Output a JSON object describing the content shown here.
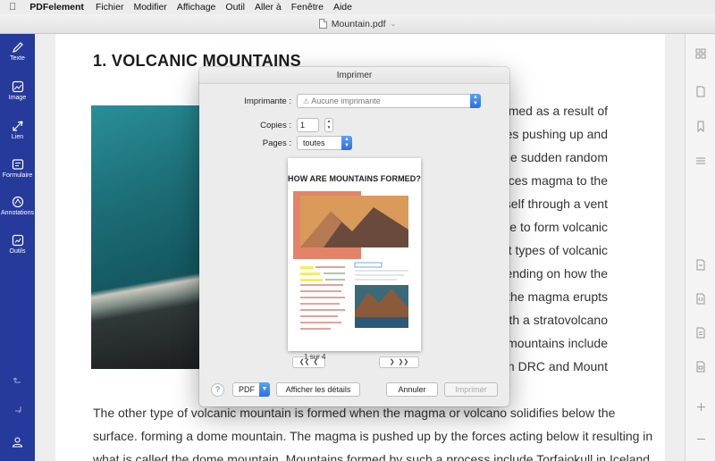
{
  "menubar": {
    "app": "PDFelement",
    "items": [
      "Fichier",
      "Modifier",
      "Affichage",
      "Outil",
      "Aller à",
      "Fenêtre",
      "Aide"
    ]
  },
  "window": {
    "filename": "Mountain.pdf"
  },
  "left_sidebar": {
    "tools": [
      {
        "label": "Texte",
        "icon": "pencil-icon"
      },
      {
        "label": "Image",
        "icon": "image-icon"
      },
      {
        "label": "Lien",
        "icon": "link-icon"
      },
      {
        "label": "Formulaire",
        "icon": "form-icon"
      },
      {
        "label": "Annotations",
        "icon": "annotation-icon"
      },
      {
        "label": "Outils",
        "icon": "tools-icon"
      }
    ]
  },
  "document": {
    "heading": "1. VOLCANIC MOUNTAINS",
    "right_lines": [
      "ormed as a result of",
      "ates pushing up and",
      "r. The sudden random",
      "rces magma to the",
      "es itself through a vent",
      "face to form volcanic",
      "rent types of volcanic",
      "depending on how the",
      "e, if the magma erupts",
      "earth a stratovolcano",
      "ch mountains include",
      "ra in DRC and Mount"
    ],
    "full_lines": [
      "The other type of volcanic mountain is formed when the magma or volcano solidifies below the",
      "surface. forming a dome mountain. The magma is pushed up by the forces acting below it resulting in",
      "what is called the dome mountain. Mountains formed by such a process include Torfajokull in Iceland"
    ]
  },
  "print_dialog": {
    "title": "Imprimer",
    "printer_label": "Imprimante :",
    "printer_value": "Aucune imprimante",
    "copies_label": "Copies :",
    "copies_value": "1",
    "pages_label": "Pages :",
    "pages_value": "toutes",
    "preview_heading": "HOW ARE MOUNTAINS FORMED?",
    "page_indicator": "1 sur 4",
    "help": "?",
    "pdf_button": "PDF",
    "details_button": "Afficher les détails",
    "cancel_button": "Annuler",
    "print_button": "Imprimer"
  },
  "colors": {
    "sidebar": "#263a9b",
    "accent": "#2c6fe4",
    "preview_orange": "#e2836a",
    "highlight_yellow": "#f5ef5a"
  }
}
